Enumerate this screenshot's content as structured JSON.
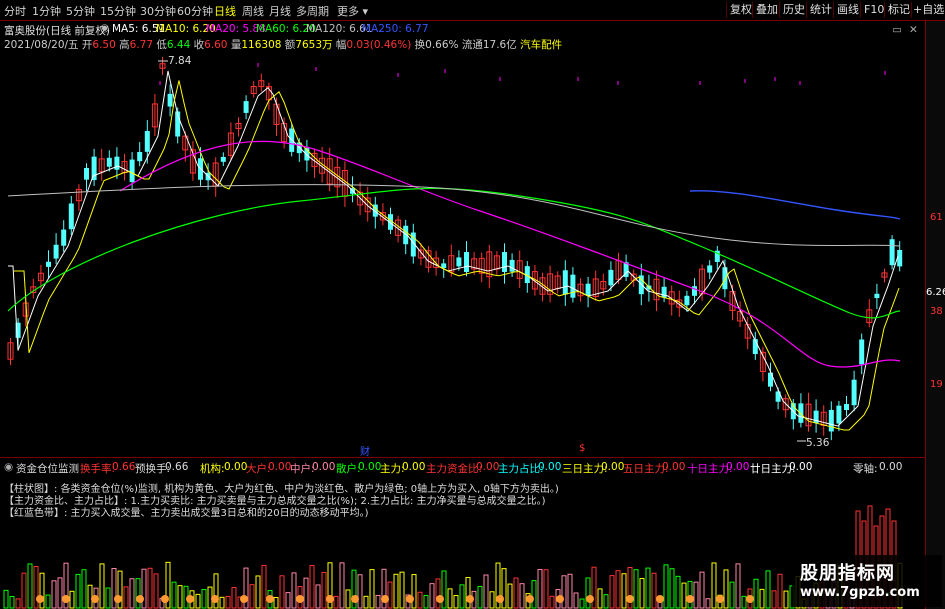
{
  "tabs": {
    "items": [
      "分时",
      "1分钟",
      "5分钟",
      "15分钟",
      "30分钟",
      "60分钟",
      "日线",
      "周线",
      "月线",
      "多周期",
      "更多"
    ],
    "active": "日线"
  },
  "toolbar": {
    "fuquan": "复权",
    "diejia": "叠加",
    "lishi": "历史",
    "tongji": "统计",
    "huaxian": "画线",
    "f10": "F10",
    "biaoji": "标记",
    "zixuan": "+自选"
  },
  "stock": {
    "name": "富奥股份(日线 前复权)",
    "date": "2021/08/20/五",
    "open_label": "开",
    "open": "6.50",
    "high_label": "高",
    "high": "6.77",
    "low_label": "低",
    "low": "6.44",
    "close_label": "收",
    "close": "6.60",
    "volume_label": "量",
    "volume": "116308",
    "amount_label": "额",
    "amount": "7653万",
    "change_label": "幅",
    "change": "0.03(0.46%)",
    "turnover_label": "换",
    "turnover": "0.66%",
    "float_label": "流通",
    "float": "17.6亿",
    "sector": "汽车配件"
  },
  "ma": {
    "ma5": "MA5: 6.51",
    "ma10": "MA10: 6.20",
    "ma20": "MA20: 5.88",
    "ma60": "MA60: 6.20",
    "ma120": "MA120: 6.61",
    "ma250": "MA250: 6.77"
  },
  "price_axis": {
    "p61": "61",
    "p626": "6.26",
    "p38": "38",
    "p19": "19"
  },
  "annotations": {
    "high": "7.84",
    "low": "5.36",
    "cai": "财",
    "s": "$"
  },
  "sub": {
    "title": "资金仓位监测",
    "huanshou_label": "换手率:",
    "huanshou": "0.66",
    "yuhuan_label": "预换手:",
    "yuhuan": "0.66",
    "jigou_label": "机构:",
    "jigou": "0.00",
    "dahu_label": "大户:",
    "dahu": "0.00",
    "zhonghu_label": "中户:",
    "zhonghu": "0.00",
    "sanhu_label": "散户:",
    "sanhu": "0.00",
    "zhuli_label": "主力:",
    "zhuli": "0.00",
    "zjb_label": "主力资金比:",
    "zjb": "0.00",
    "zzb_label": "主力占比:",
    "zzb": "0.00",
    "d3_label": "三日主力:",
    "d3": "0.00",
    "d5_label": "五日主力:",
    "d5": "0.00",
    "d10_label": "十日主力:",
    "d10": "0.00",
    "d20_label": "廿日主力:",
    "d20": "0.00",
    "lingzhou_label": "零轴:",
    "lingzhou": "0.00",
    "desc1": "【柱状图】: 各类资金仓位(%)监测, 机构为黄色、大户为红色、中户为淡红色、散户为绿色; 0轴上方为买入, 0轴下方为卖出。)",
    "desc2": "【主力资金比、主力占比】: 1.主力买卖比: 主力买卖量与主力总成交量之比(%); 2.主力占比: 主力净买量与总成交量之比。)",
    "desc3": "【红蓝色带】: 主力买入成交量、主力卖出成交量3日总和的20日的动态移动平均。)"
  },
  "watermark": {
    "title": "股朋指标网",
    "url": "www.7gpzb.com"
  },
  "colors": {
    "up": "#ff3333",
    "down": "#54ffff",
    "ma5": "#ffffff",
    "ma10": "#ffff00",
    "ma20": "#ff00ff",
    "ma60": "#00ff00",
    "ma120": "#c0c0c0",
    "ma250": "#3355ff",
    "frame": "#7a0000"
  }
}
